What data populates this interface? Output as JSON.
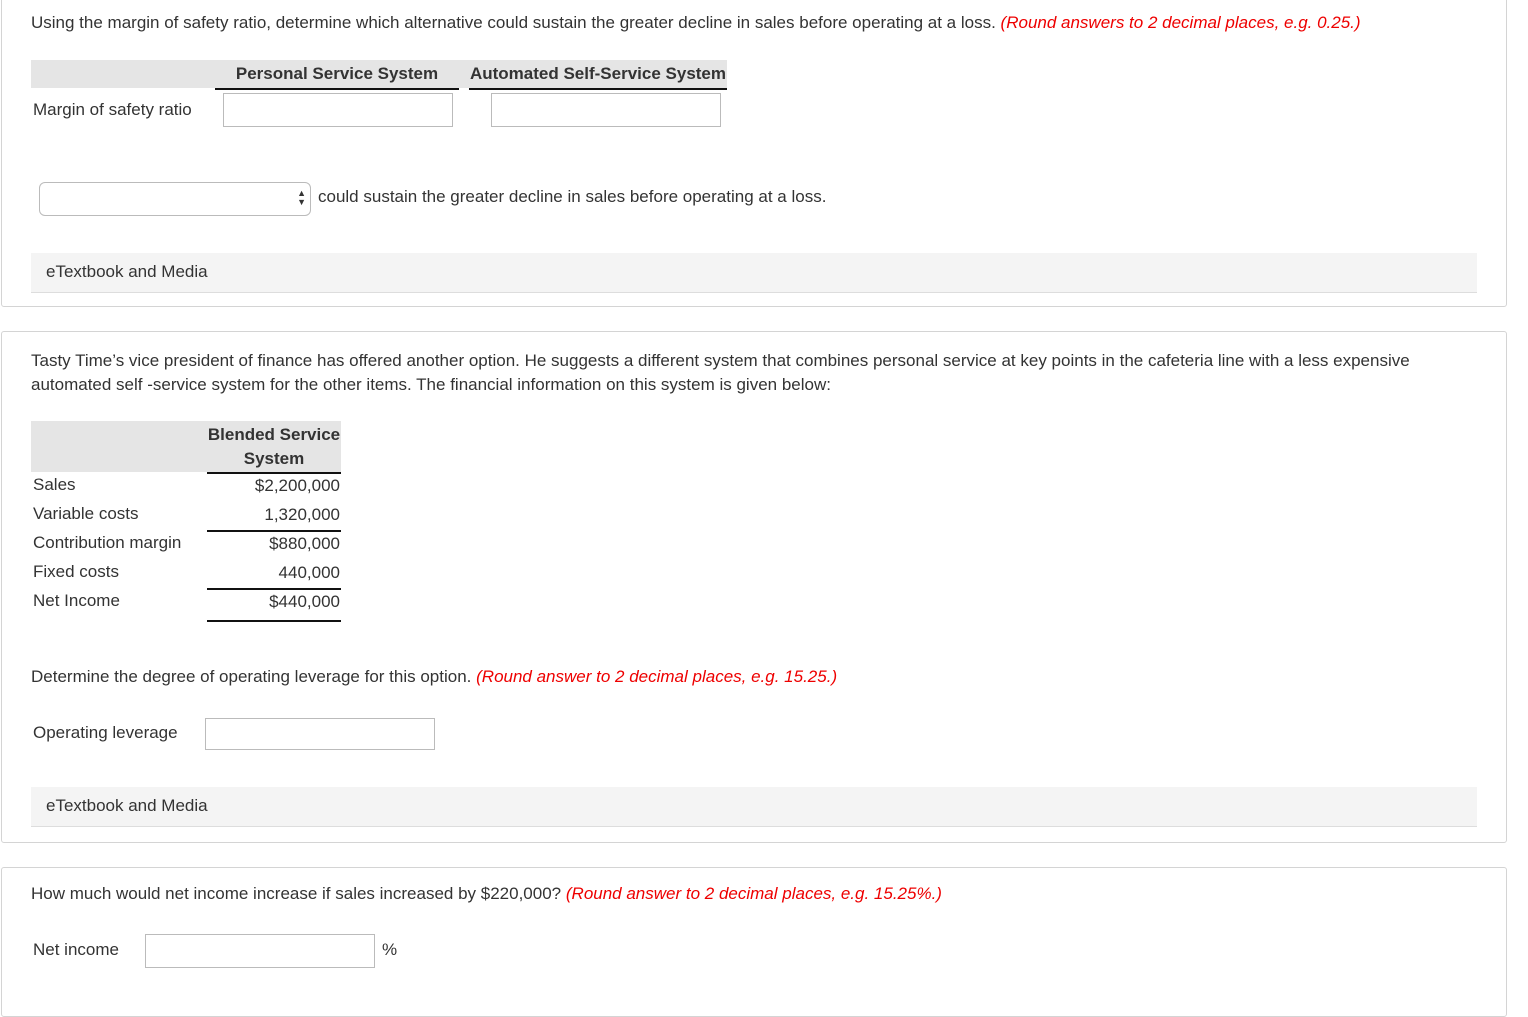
{
  "section1": {
    "instruction": "Using the margin of safety ratio, determine which alternative could sustain the greater decline in sales before operating at a loss.",
    "hint": "(Round answers to 2 decimal places, e.g. 0.25.)",
    "columns": [
      "Personal Service System",
      "Automated Self-Service System"
    ],
    "row_label": "Margin of safety ratio",
    "inputs": [
      "",
      ""
    ],
    "select_value": "",
    "select_suffix": "could sustain the greater decline in sales before operating at a loss.",
    "etextbook": "eTextbook and Media"
  },
  "section2": {
    "intro": "Tasty Time’s vice president of finance has offered another option. He suggests a different system that combines personal service at key points in the cafeteria line with a less expensive automated self -service system for the other items. The financial information on this system is given below:",
    "table_header": [
      "Blended Service",
      "System"
    ],
    "rows": [
      {
        "label": "Sales",
        "value": "$2,200,000"
      },
      {
        "label": "Variable costs",
        "value": "1,320,000"
      },
      {
        "label": "Contribution margin",
        "value": "$880,000"
      },
      {
        "label": "Fixed costs",
        "value": "440,000"
      },
      {
        "label": "Net Income",
        "value": "$440,000"
      }
    ],
    "question": "Determine the degree of operating leverage for this option.",
    "hint": "(Round answer to 2 decimal places, e.g. 15.25.)",
    "input_label": "Operating leverage",
    "input_value": "",
    "etextbook": "eTextbook and Media"
  },
  "section3": {
    "question": "How much would net income increase if sales increased by $220,000?",
    "hint": "(Round answer to 2 decimal places, e.g. 15.25%.)",
    "input_label": "Net income",
    "input_value": "",
    "unit": "%"
  }
}
